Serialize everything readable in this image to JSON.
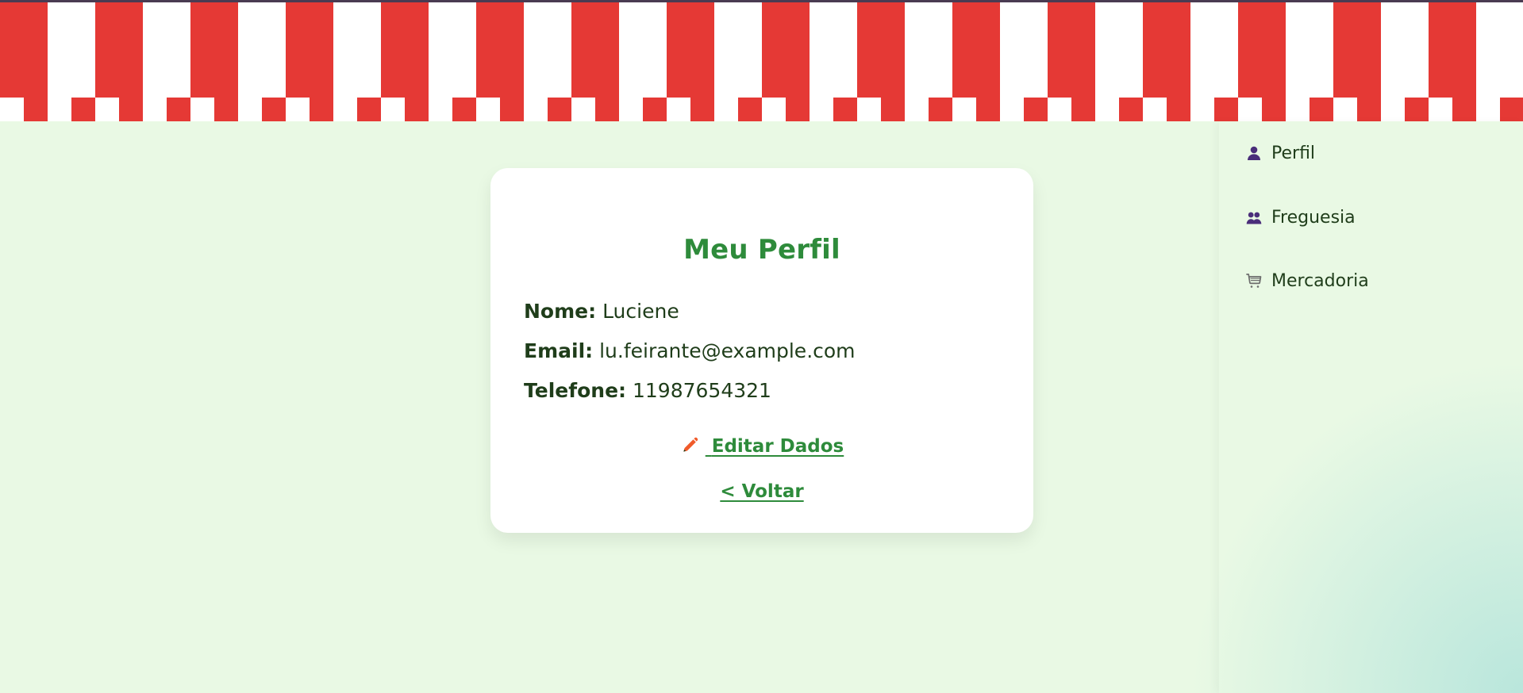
{
  "header": {
    "pattern": "red-white-awning",
    "colors": {
      "red": "#e53935",
      "white": "#ffffff"
    }
  },
  "sidebar": {
    "items": [
      {
        "icon": "user-icon",
        "label": "Perfil"
      },
      {
        "icon": "users-icon",
        "label": "Freguesia"
      },
      {
        "icon": "cart-icon",
        "label": "Mercadoria"
      }
    ]
  },
  "profile": {
    "title": "Meu Perfil",
    "fields": [
      {
        "key": "Nome:",
        "value": "Luciene"
      },
      {
        "key": "Email:",
        "value": "lu.feirante@example.com"
      },
      {
        "key": "Telefone:",
        "value": "11987654321"
      }
    ],
    "edit_link": "Editar Dados",
    "back_link": "< Voltar",
    "colors": {
      "title": "#2e8b3b",
      "text": "#1f3d1a",
      "link": "#2e8b3b",
      "background": "#e9f9e4",
      "card": "#ffffff"
    }
  }
}
